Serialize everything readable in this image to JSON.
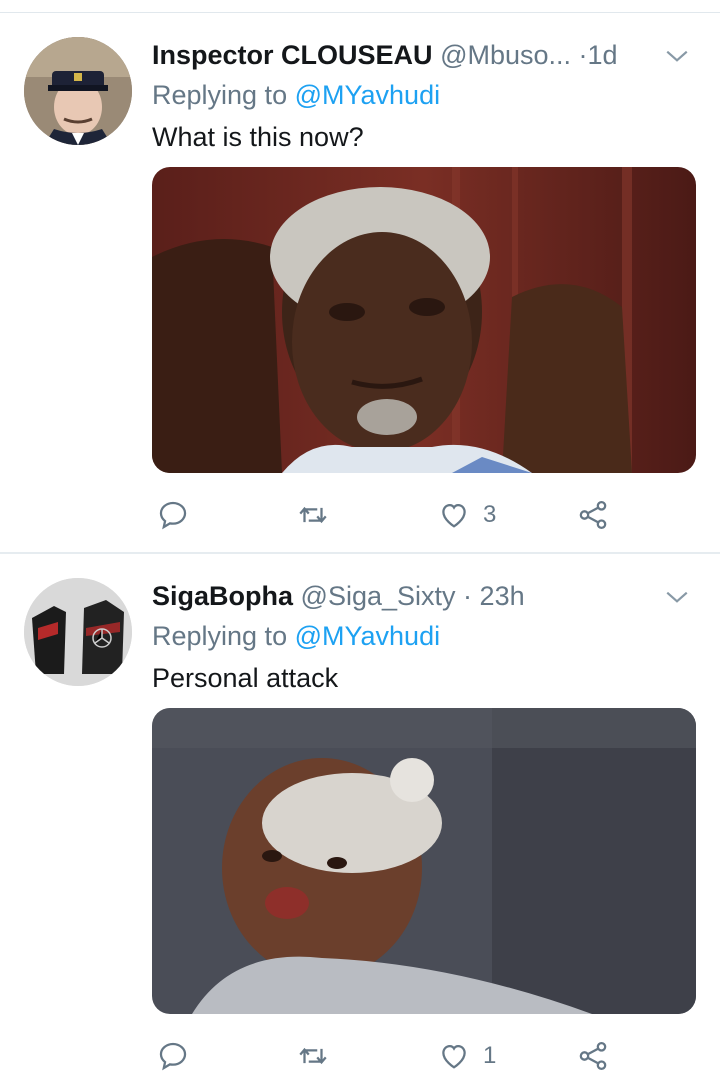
{
  "tweets": [
    {
      "name": "Inspector CLOUSEAU",
      "handle": "@Mbuso...",
      "separator": "·",
      "time": "1d",
      "replying_prefix": "Replying to",
      "replying_to": "@MYavhudi",
      "text": "What is this now?",
      "reply_count": "",
      "retweet_count": "",
      "like_count": "3",
      "avatar_icon": "avatar-police-officer",
      "media_subject": "photo"
    },
    {
      "name": "SigaBopha",
      "handle": "@Siga_Sixty",
      "separator": "·",
      "time": "23h",
      "replying_prefix": "Replying to",
      "replying_to": "@MYavhudi",
      "text": "Personal attack",
      "reply_count": "",
      "retweet_count": "",
      "like_count": "1",
      "avatar_icon": "avatar-jacket",
      "media_subject": "photo"
    }
  ],
  "colors": {
    "link": "#1da1f2",
    "muted": "#657786",
    "text": "#14171a",
    "divider": "#e6ecf0"
  }
}
